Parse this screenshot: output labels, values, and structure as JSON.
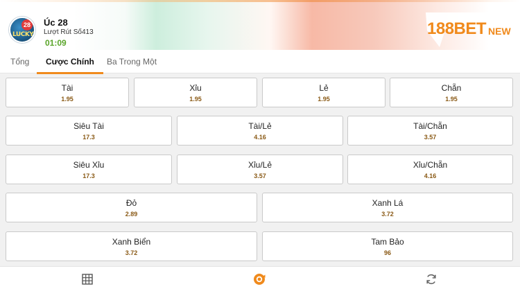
{
  "header": {
    "game_title": "Úc 28",
    "round_label": "Lượt Rút Số413",
    "countdown": "01:09",
    "logo_text": "LUCKY",
    "logo_number": "28",
    "brand": {
      "part1": "188",
      "part2": "BET",
      "part3": "NEW"
    }
  },
  "tabs": [
    {
      "label": "Tổng"
    },
    {
      "label": "Cược Chính"
    },
    {
      "label": "Ba Trong Một"
    }
  ],
  "active_tab": "Cược Chính",
  "bets": {
    "row1": [
      {
        "name": "Tài",
        "odds": "1.95"
      },
      {
        "name": "Xỉu",
        "odds": "1.95"
      },
      {
        "name": "Lẻ",
        "odds": "1.95"
      },
      {
        "name": "Chẵn",
        "odds": "1.95"
      }
    ],
    "row2": [
      {
        "name": "Siêu Tài",
        "odds": "17.3"
      },
      {
        "name": "Tài/Lẻ",
        "odds": "4.16"
      },
      {
        "name": "Tài/Chẵn",
        "odds": "3.57"
      }
    ],
    "row3": [
      {
        "name": "Siêu Xỉu",
        "odds": "17.3"
      },
      {
        "name": "Xỉu/Lẻ",
        "odds": "3.57"
      },
      {
        "name": "Xỉu/Chẵn",
        "odds": "4.16"
      }
    ],
    "row4": [
      {
        "name": "Đỏ",
        "odds": "2.89"
      },
      {
        "name": "Xanh Lá",
        "odds": "3.72"
      }
    ],
    "row5": [
      {
        "name": "Xanh Biển",
        "odds": "3.72"
      },
      {
        "name": "Tam Bảo",
        "odds": "96"
      }
    ]
  },
  "bottom_icons": [
    "grid-icon",
    "ball-icon",
    "refresh-icon"
  ],
  "colors": {
    "accent": "#f08a1c",
    "countdown": "#5aa52a",
    "odds": "#8a5a16"
  }
}
